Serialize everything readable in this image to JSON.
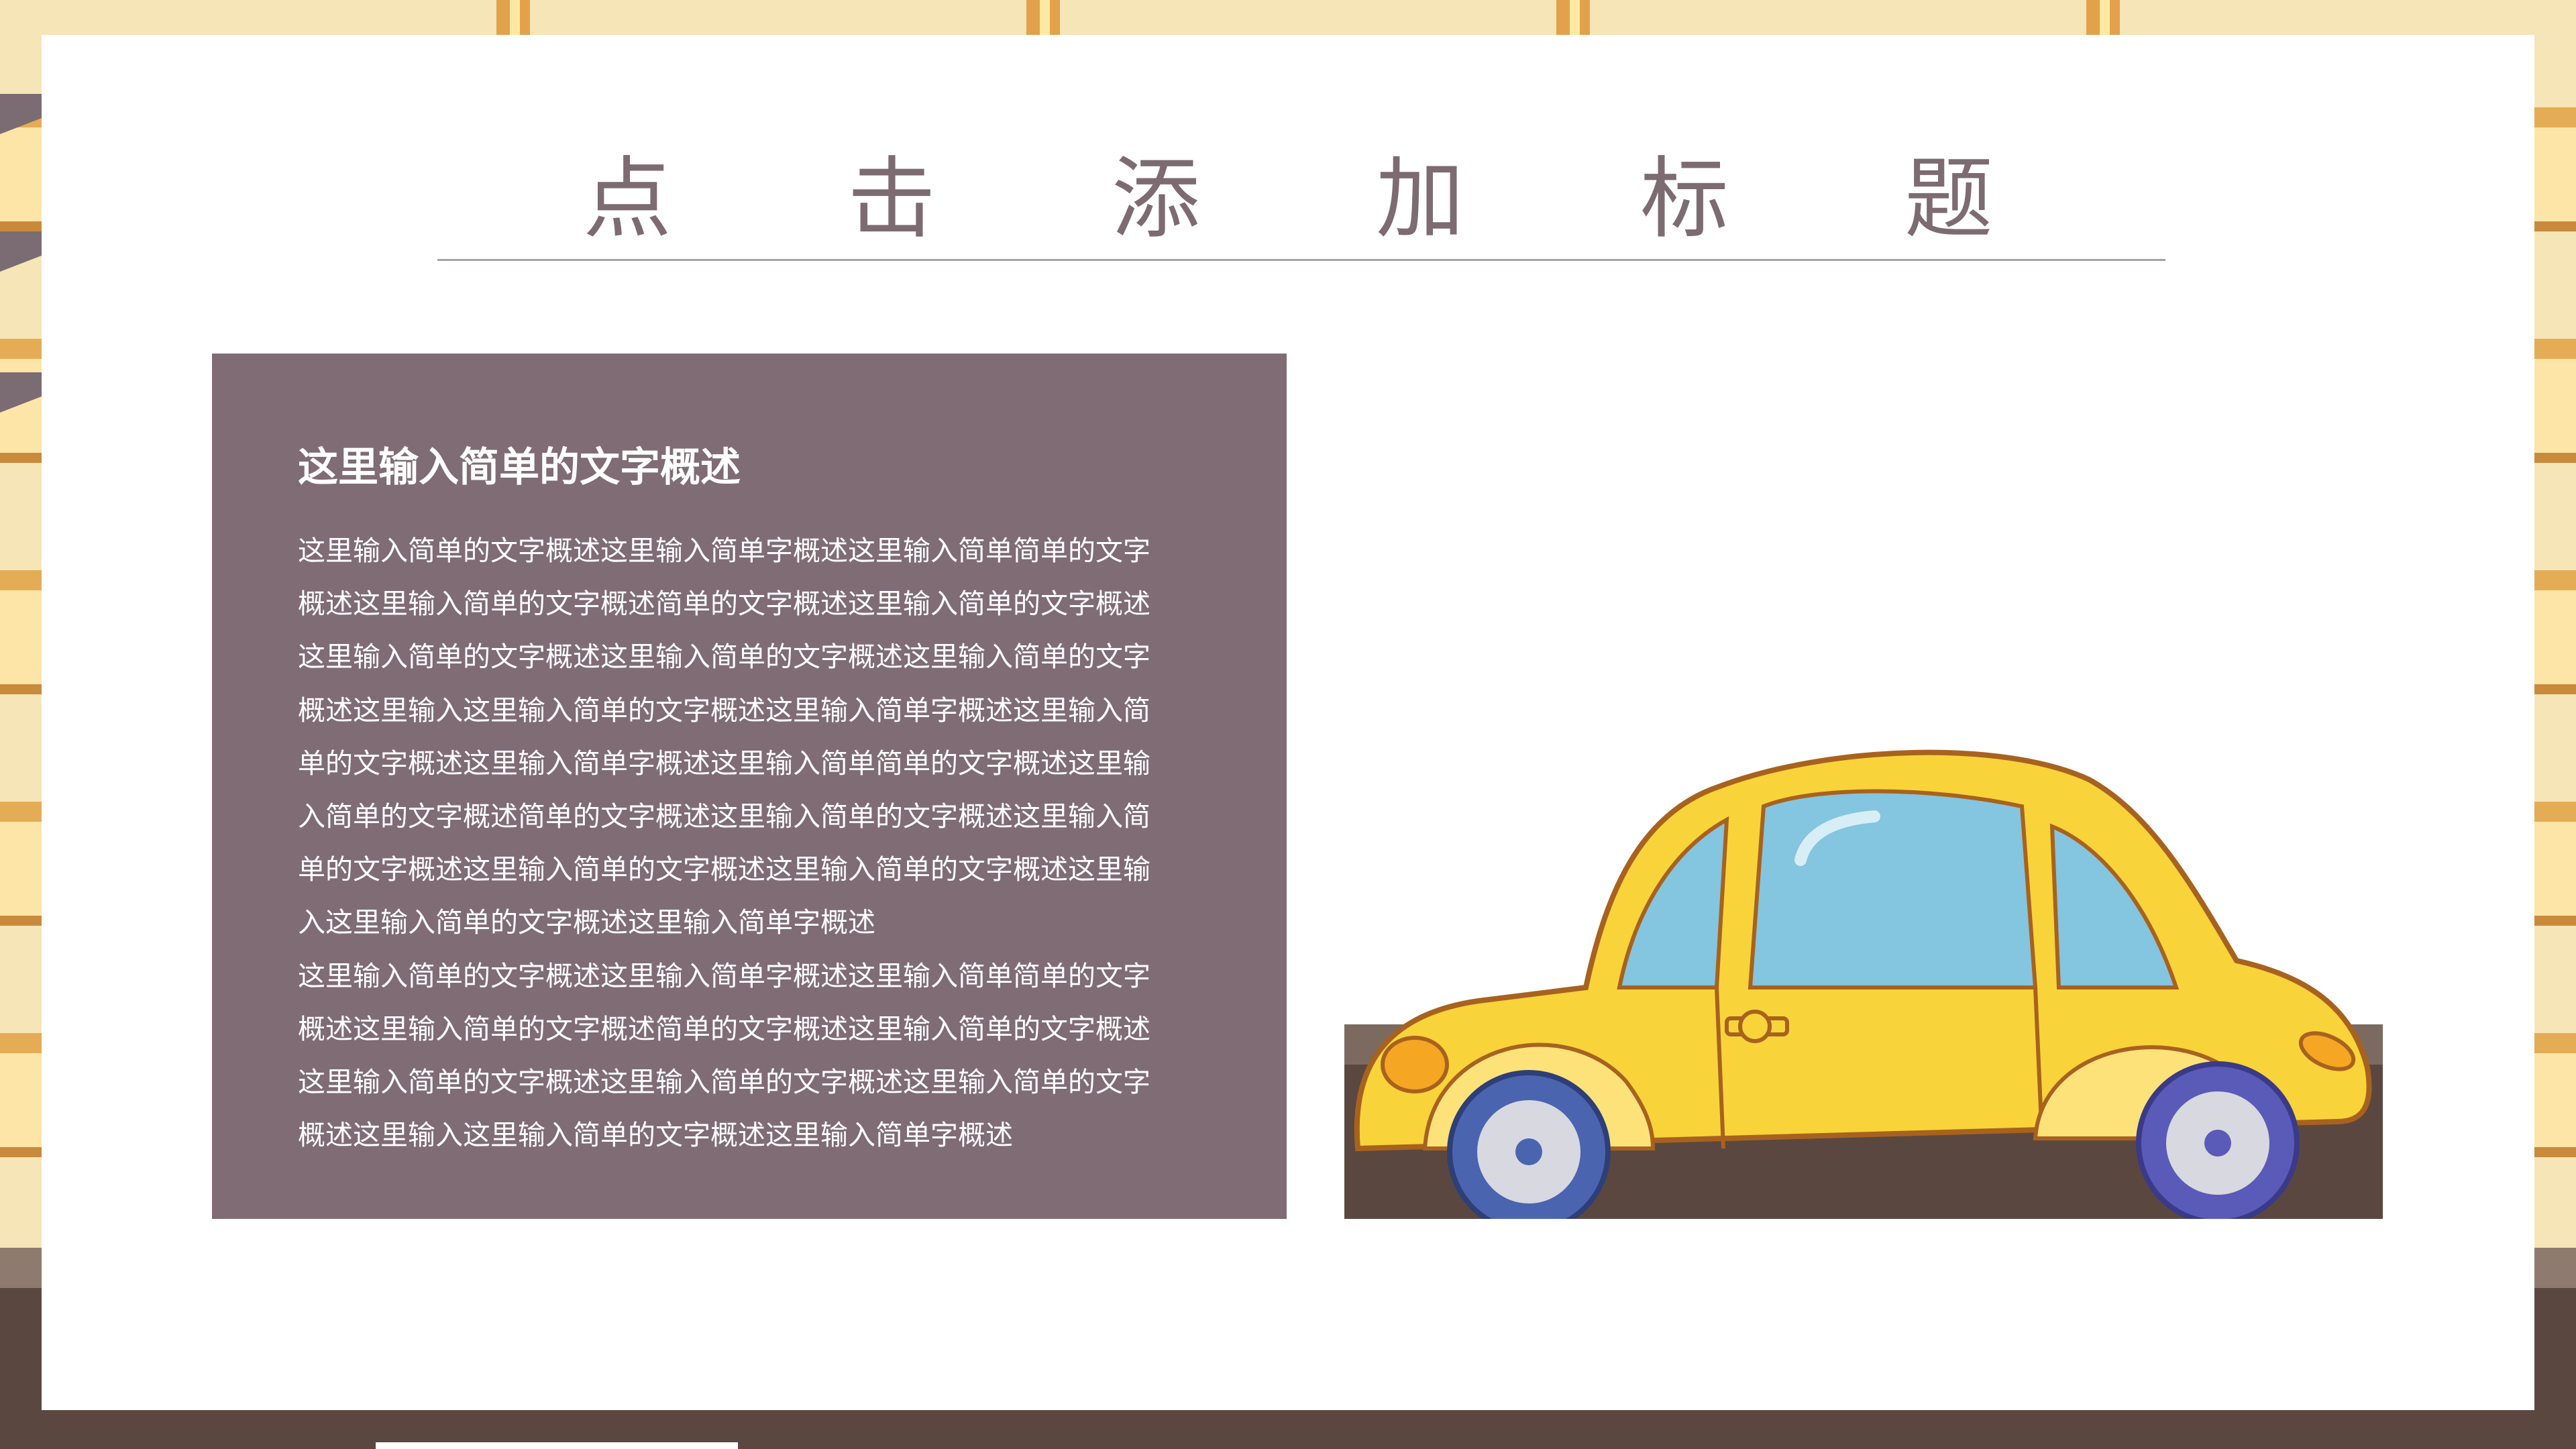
{
  "slide": {
    "title": "点 击 添 加 标 题",
    "card": {
      "heading": "这里输入简单的文字概述",
      "lines": [
        "这里输入简单的文字概述这里输入简单字概述这里输入简单简单的文字",
        "概述这里输入简单的文字概述简单的文字概述这里输入简单的文字概述",
        "这里输入简单的文字概述这里输入简单的文字概述这里输入简单的文字",
        "概述这里输入这里输入简单的文字概述这里输入简单字概述这里输入简",
        "单的文字概述这里输入简单字概述这里输入简单简单的文字概述这里输",
        "入简单的文字概述简单的文字概述这里输入简单的文字概述这里输入简",
        "单的文字概述这里输入简单的文字概述这里输入简单的文字概述这里输",
        "入这里输入简单的文字概述这里输入简单字概述",
        "这里输入简单的文字概述这里输入简单字概述这里输入简单简单的文字",
        "概述这里输入简单的文字概述简单的文字概述这里输入简单的文字概述",
        "这里输入简单的文字概述这里输入简单的文字概述这里输入简单的文字",
        "概述这里输入这里输入简单的文字概述这里输入简单字概述"
      ]
    },
    "illustration": {
      "icon": "yellow-car-icon",
      "colors": {
        "body": "#f8d33a",
        "window": "#84c5e0",
        "outline": "#a8621f",
        "wheel": "#4a64b0",
        "ground": "#5a4840"
      }
    }
  },
  "colors": {
    "title": "#7d6b72",
    "card_bg": "#7f6c74",
    "background": "#f6e5b6"
  }
}
